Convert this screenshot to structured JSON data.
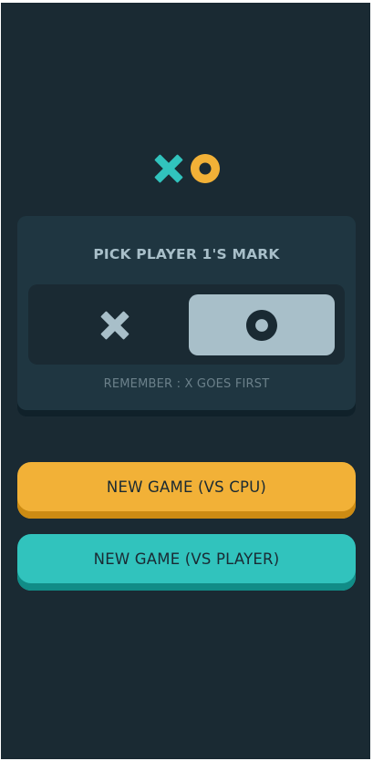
{
  "logo": {
    "icons": [
      "x-mark-icon",
      "o-mark-icon"
    ],
    "x_color": "#31c3bd",
    "o_color": "#f2b137"
  },
  "mark_picker": {
    "title": "PICK PLAYER 1'S MARK",
    "options": [
      {
        "mark": "X",
        "icon": "x-mark-icon",
        "selected": false
      },
      {
        "mark": "O",
        "icon": "o-mark-icon",
        "selected": true
      }
    ],
    "note": "REMEMBER : X GOES FIRST"
  },
  "buttons": {
    "vs_cpu": "NEW GAME (VS CPU)",
    "vs_player": "NEW GAME (VS PLAYER)"
  },
  "colors": {
    "background": "#1a2a33",
    "card": "#1f3641",
    "silver": "#a8bfc9",
    "teal": "#31c3bd",
    "yellow": "#f2b137"
  }
}
